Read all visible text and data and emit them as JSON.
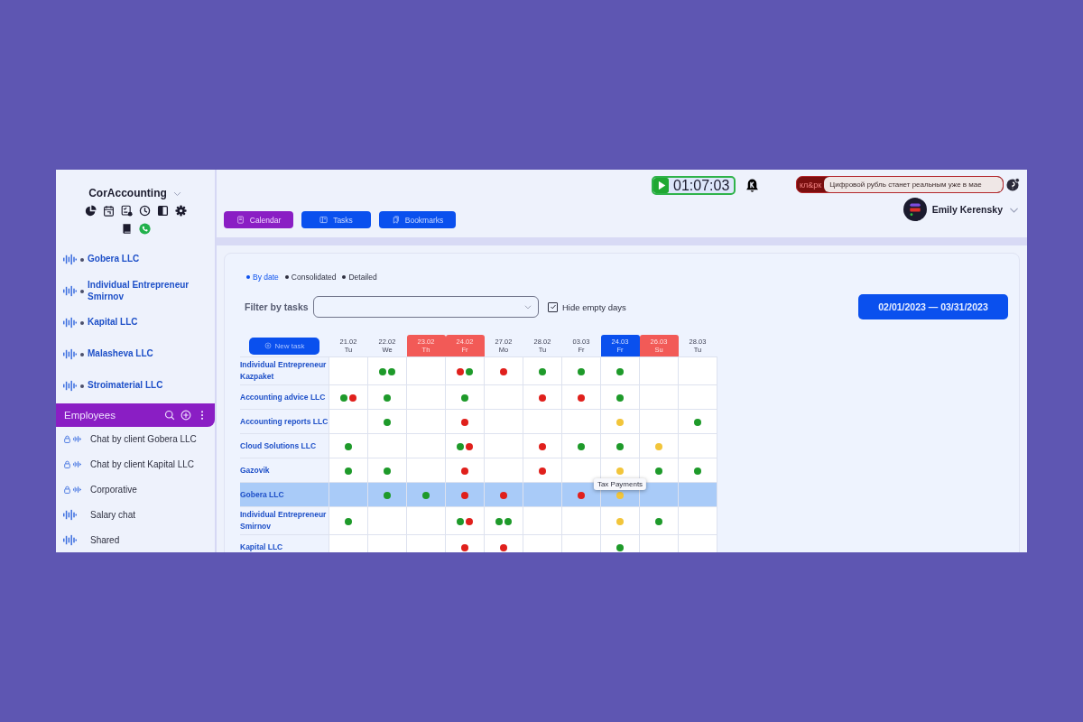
{
  "sidebar": {
    "app_name": "CorAccounting",
    "clients": [
      {
        "name": "Gobera LLC"
      },
      {
        "name": "Individual Entrepreneur Smirnov"
      },
      {
        "name": "Kapital LLC"
      },
      {
        "name": "Malasheva LLC"
      },
      {
        "name": "Stroimaterial LLC"
      }
    ],
    "section": {
      "title": "Employees"
    },
    "chats": [
      {
        "name": "Chat by client Gobera LLC",
        "locked": true
      },
      {
        "name": "Chat by client Kapital LLC",
        "locked": true
      },
      {
        "name": "Corporative",
        "locked": true
      },
      {
        "name": "Salary chat",
        "locked": false
      },
      {
        "name": "Shared",
        "locked": false
      }
    ]
  },
  "header": {
    "timer": "01:07:03",
    "news": {
      "brand": "кл&рк",
      "headline": "Цифровой рубль станет реальным уже в мае"
    },
    "user": "Emily Kerensky",
    "nav": [
      {
        "label": "Calendar",
        "selected": true
      },
      {
        "label": "Tasks",
        "selected": false
      },
      {
        "label": "Bookmarks",
        "selected": false
      }
    ]
  },
  "view_modes": [
    {
      "label": "By date",
      "selected": true
    },
    {
      "label": "Consolidated",
      "selected": false
    },
    {
      "label": "Detailed",
      "selected": false
    }
  ],
  "filter": {
    "label": "Filter by tasks"
  },
  "hide_empty": {
    "label": "Hide empty days",
    "checked": true
  },
  "date_range": "02/01/2023 — 03/31/2023",
  "table": {
    "new_task": "New task",
    "columns": [
      {
        "date": "21.02",
        "day": "Tu",
        "kind": "normal"
      },
      {
        "date": "22.02",
        "day": "We",
        "kind": "normal"
      },
      {
        "date": "23.02",
        "day": "Th",
        "kind": "holiday"
      },
      {
        "date": "24.02",
        "day": "Fr",
        "kind": "holiday"
      },
      {
        "date": "27.02",
        "day": "Mo",
        "kind": "normal"
      },
      {
        "date": "28.02",
        "day": "Tu",
        "kind": "normal"
      },
      {
        "date": "03.03",
        "day": "Fr",
        "kind": "normal"
      },
      {
        "date": "24.03",
        "day": "Fr",
        "kind": "current"
      },
      {
        "date": "26.03",
        "day": "Su",
        "kind": "holiday"
      },
      {
        "date": "28.03",
        "day": "Tu",
        "kind": "normal"
      }
    ],
    "rows": [
      {
        "name": "Individual Entrepreneur Kazpaket",
        "selected": false,
        "cells": [
          [],
          [
            {
              "color": "#1e9a2a"
            },
            {
              "color": "#1e9a2a"
            }
          ],
          [],
          [
            {
              "color": "#e0201c"
            },
            {
              "color": "#1e9a2a"
            }
          ],
          [
            {
              "color": "#e0201c"
            }
          ],
          [
            {
              "color": "#1e9a2a"
            }
          ],
          [
            {
              "color": "#1e9a2a"
            }
          ],
          [
            {
              "color": "#1e9a2a"
            }
          ],
          [],
          []
        ]
      },
      {
        "name": "Accounting advice LLC",
        "selected": false,
        "cells": [
          [
            {
              "color": "#1e9a2a"
            },
            {
              "color": "#e0201c"
            }
          ],
          [
            {
              "color": "#1e9a2a"
            }
          ],
          [],
          [
            {
              "color": "#1e9a2a"
            }
          ],
          [],
          [
            {
              "color": "#e0201c"
            }
          ],
          [
            {
              "color": "#e0201c"
            }
          ],
          [
            {
              "color": "#1e9a2a"
            }
          ],
          [],
          []
        ]
      },
      {
        "name": "Accounting reports LLC",
        "selected": false,
        "cells": [
          [],
          [
            {
              "color": "#1e9a2a"
            }
          ],
          [],
          [
            {
              "color": "#e0201c"
            }
          ],
          [],
          [],
          [],
          [
            {
              "color": "#f2c53a"
            }
          ],
          [],
          [
            {
              "color": "#1e9a2a"
            }
          ]
        ]
      },
      {
        "name": "Cloud Solutions LLC",
        "selected": false,
        "cells": [
          [
            {
              "color": "#1e9a2a"
            }
          ],
          [],
          [],
          [
            {
              "color": "#1e9a2a"
            },
            {
              "color": "#e0201c"
            }
          ],
          [],
          [
            {
              "color": "#e0201c"
            }
          ],
          [
            {
              "color": "#1e9a2a"
            }
          ],
          [
            {
              "color": "#1e9a2a"
            }
          ],
          [
            {
              "color": "#f2c53a"
            }
          ],
          []
        ]
      },
      {
        "name": "Gazovik",
        "selected": false,
        "cells": [
          [
            {
              "color": "#1e9a2a"
            }
          ],
          [
            {
              "color": "#1e9a2a"
            }
          ],
          [],
          [
            {
              "color": "#e0201c"
            }
          ],
          [],
          [
            {
              "color": "#e0201c"
            }
          ],
          [],
          [
            {
              "color": "#f2c53a"
            }
          ],
          [
            {
              "color": "#1e9a2a"
            }
          ],
          [
            {
              "color": "#1e9a2a"
            }
          ]
        ]
      },
      {
        "name": "Gobera LLC",
        "selected": true,
        "cells": [
          [],
          [
            {
              "color": "#1e9a2a"
            }
          ],
          [
            {
              "color": "#1e9a2a"
            }
          ],
          [
            {
              "color": "#e0201c"
            }
          ],
          [
            {
              "color": "#e0201c"
            }
          ],
          [],
          [
            {
              "color": "#e0201c"
            }
          ],
          [
            {
              "color": "#f2c53a",
              "tooltip": "Tax Payments"
            }
          ],
          [],
          []
        ]
      },
      {
        "name": "Individual Entrepreneur Smirnov",
        "selected": false,
        "cells": [
          [
            {
              "color": "#1e9a2a"
            }
          ],
          [],
          [],
          [
            {
              "color": "#1e9a2a"
            },
            {
              "color": "#e0201c"
            }
          ],
          [
            {
              "color": "#1e9a2a"
            },
            {
              "color": "#1e9a2a"
            }
          ],
          [],
          [],
          [
            {
              "color": "#f2c53a"
            }
          ],
          [
            {
              "color": "#1e9a2a"
            }
          ],
          []
        ]
      },
      {
        "name": "Kapital LLC",
        "selected": false,
        "cells": [
          [],
          [],
          [],
          [
            {
              "color": "#e0201c"
            }
          ],
          [
            {
              "color": "#e0201c"
            }
          ],
          [],
          [],
          [
            {
              "color": "#1e9a2a"
            }
          ],
          [],
          []
        ]
      }
    ]
  }
}
